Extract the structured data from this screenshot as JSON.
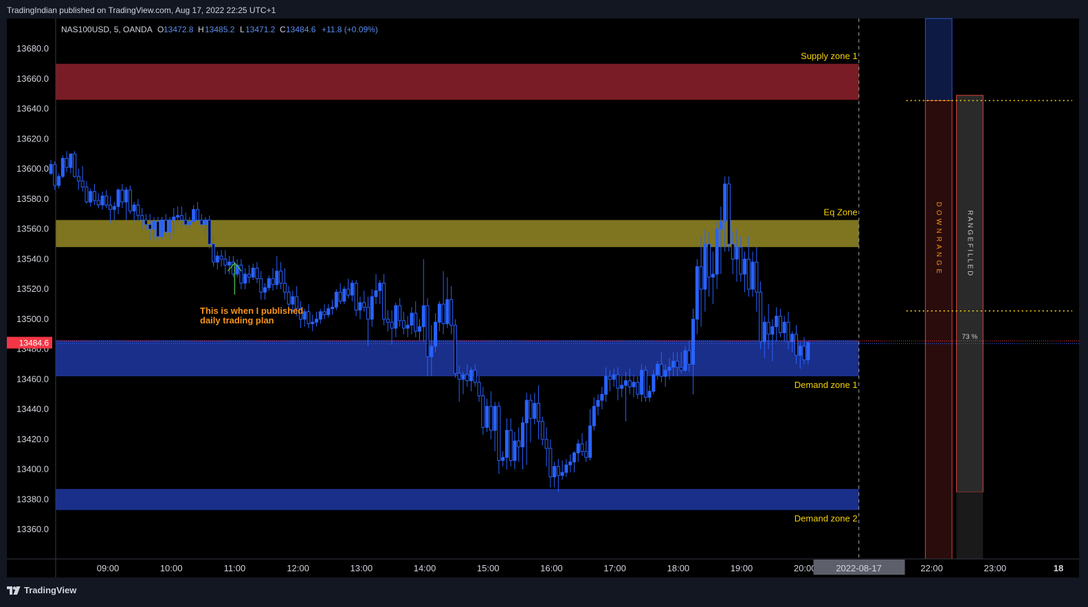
{
  "header": {
    "published_text": "TradingIndian published on TradingView.com, Aug 17, 2022 22:25 UTC+1"
  },
  "footer": {
    "brand": "TradingView"
  },
  "legend": {
    "symbol": "NAS100USD, 5, OANDA",
    "o_label": "O",
    "o_value": "13472.8",
    "h_label": "H",
    "h_value": "13485.2",
    "l_label": "L",
    "l_value": "13471.2",
    "c_label": "C",
    "c_value": "13484.6",
    "change": "+11.8 (+0.09%)"
  },
  "colors": {
    "background": "#000000",
    "frame": "#131722",
    "candle": "#2962ff",
    "supply_zone": "#7a1c25",
    "eq_zone": "#7f7520",
    "demand_zone": "#1a2f8a",
    "zone_label": "#f5d10a",
    "annotation": "#f7931a",
    "arrow": "#4caf50",
    "last_price": "#f23645"
  },
  "chart_data": {
    "type": "candlestick",
    "symbol": "NAS100USD",
    "timeframe": "5",
    "exchange": "OANDA",
    "ylim": [
      13340,
      13695
    ],
    "yticks": [
      13680.0,
      13660.0,
      13640.0,
      13620.0,
      13600.0,
      13580.0,
      13560.0,
      13540.0,
      13520.0,
      13500.0,
      13480.0,
      13460.0,
      13440.0,
      13420.0,
      13400.0,
      13380.0,
      13360.0
    ],
    "x_start_hour": 8.1,
    "x_end_hour": 24.0,
    "xticks": [
      {
        "hour": 9,
        "label": "09:00"
      },
      {
        "hour": 10,
        "label": "10:00"
      },
      {
        "hour": 11,
        "label": "11:00"
      },
      {
        "hour": 12,
        "label": "12:00"
      },
      {
        "hour": 13,
        "label": "13:00"
      },
      {
        "hour": 14,
        "label": "14:00"
      },
      {
        "hour": 15,
        "label": "15:00"
      },
      {
        "hour": 16,
        "label": "16:00"
      },
      {
        "hour": 17,
        "label": "17:00"
      },
      {
        "hour": 18,
        "label": "18:00"
      },
      {
        "hour": 19,
        "label": "19:00"
      },
      {
        "hour": 20,
        "label": "20:00"
      },
      {
        "hour": 21,
        "label": "21:00"
      },
      {
        "hour": 22,
        "label": "22:00"
      },
      {
        "hour": 23,
        "label": "23:00"
      },
      {
        "hour": 24,
        "label": "18"
      }
    ],
    "current_time_label": "2022-08-17",
    "current_time_hour": 20.85,
    "last_price": 13484.6,
    "last_price_label": "13484.6",
    "zones": [
      {
        "name": "Supply zone 1",
        "top": 13670,
        "bottom": 13646,
        "color": "#7a1c25"
      },
      {
        "name": "Eq Zone",
        "top": 13566,
        "bottom": 13548,
        "color": "#7f7520"
      },
      {
        "name": "Demand zone 1",
        "top": 13486,
        "bottom": 13462,
        "color": "#1a2f8a"
      },
      {
        "name": "Demand zone 2",
        "top": 13387,
        "bottom": 13373,
        "color": "#1a2f8a"
      }
    ],
    "dotted_levels": [
      13645.5,
      13505.5
    ],
    "down_range": {
      "label": "DOWN RANGE",
      "top": 13645.5,
      "bottom": 13340,
      "above_top": 13695
    },
    "range_filled": {
      "label": "RANGE FILLED",
      "percent": "73 %",
      "top": 13649,
      "bottom": 13385
    },
    "annotation": {
      "line1": "This is when I published",
      "line2": "daily trading plan",
      "hour": 11.0,
      "price": 13542
    },
    "candles": [
      [
        13597,
        13606,
        13596,
        13603
      ],
      [
        13603,
        13605,
        13586,
        13589
      ],
      [
        13589,
        13597,
        13587,
        13595
      ],
      [
        13595,
        13609,
        13594,
        13607
      ],
      [
        13607,
        13612,
        13598,
        13601
      ],
      [
        13601,
        13610,
        13597,
        13610
      ],
      [
        13610,
        13612,
        13594,
        13595
      ],
      [
        13595,
        13600,
        13586,
        13592
      ],
      [
        13592,
        13602,
        13585,
        13588
      ],
      [
        13588,
        13592,
        13577,
        13578
      ],
      [
        13578,
        13587,
        13575,
        13585
      ],
      [
        13585,
        13590,
        13576,
        13579
      ],
      [
        13579,
        13584,
        13574,
        13576
      ],
      [
        13576,
        13585,
        13573,
        13582
      ],
      [
        13582,
        13586,
        13574,
        13576
      ],
      [
        13576,
        13582,
        13564,
        13573
      ],
      [
        13573,
        13578,
        13566,
        13575
      ],
      [
        13575,
        13587,
        13570,
        13586
      ],
      [
        13586,
        13590,
        13574,
        13578
      ],
      [
        13578,
        13588,
        13566,
        13586
      ],
      [
        13586,
        13589,
        13570,
        13572
      ],
      [
        13572,
        13578,
        13565,
        13576
      ],
      [
        13576,
        13580,
        13566,
        13569
      ],
      [
        13569,
        13574,
        13560,
        13566
      ],
      [
        13566,
        13570,
        13559,
        13563
      ],
      [
        13563,
        13570,
        13553,
        13560
      ],
      [
        13560,
        13568,
        13552,
        13565
      ],
      [
        13565,
        13568,
        13553,
        13555
      ],
      [
        13555,
        13568,
        13553,
        13566
      ],
      [
        13566,
        13570,
        13555,
        13558
      ],
      [
        13558,
        13568,
        13553,
        13566
      ],
      [
        13566,
        13574,
        13557,
        13568
      ],
      [
        13568,
        13575,
        13563,
        13569
      ],
      [
        13569,
        13575,
        13561,
        13566
      ],
      [
        13566,
        13571,
        13562,
        13563
      ],
      [
        13563,
        13568,
        13560,
        13565
      ],
      [
        13565,
        13576,
        13563,
        13573
      ],
      [
        13573,
        13578,
        13565,
        13566
      ],
      [
        13566,
        13570,
        13561,
        13563
      ],
      [
        13563,
        13568,
        13556,
        13566
      ],
      [
        13566,
        13569,
        13547,
        13550
      ],
      [
        13550,
        13556,
        13535,
        13538
      ],
      [
        13538,
        13545,
        13533,
        13542
      ],
      [
        13542,
        13546,
        13535,
        13540
      ],
      [
        13540,
        13546,
        13530,
        13536
      ],
      [
        13536,
        13542,
        13530,
        13538
      ],
      [
        13538,
        13542,
        13528,
        13530
      ],
      [
        13530,
        13540,
        13528,
        13536
      ],
      [
        13536,
        13540,
        13520,
        13524
      ],
      [
        13524,
        13534,
        13520,
        13530
      ],
      [
        13530,
        13536,
        13524,
        13528
      ],
      [
        13528,
        13537,
        13526,
        13534
      ],
      [
        13534,
        13538,
        13524,
        13527
      ],
      [
        13527,
        13532,
        13513,
        13518
      ],
      [
        13518,
        13524,
        13513,
        13521
      ],
      [
        13521,
        13529,
        13519,
        13527
      ],
      [
        13527,
        13534,
        13519,
        13523
      ],
      [
        13523,
        13542,
        13520,
        13532
      ],
      [
        13532,
        13538,
        13520,
        13524
      ],
      [
        13524,
        13534,
        13513,
        13518
      ],
      [
        13518,
        13522,
        13505,
        13510
      ],
      [
        13510,
        13519,
        13505,
        13515
      ],
      [
        13515,
        13522,
        13502,
        13507
      ],
      [
        13507,
        13512,
        13494,
        13500
      ],
      [
        13500,
        13507,
        13495,
        13505
      ],
      [
        13505,
        13510,
        13494,
        13497
      ],
      [
        13497,
        13503,
        13492,
        13498
      ],
      [
        13498,
        13505,
        13495,
        13500
      ],
      [
        13500,
        13507,
        13497,
        13505
      ],
      [
        13505,
        13510,
        13500,
        13503
      ],
      [
        13503,
        13510,
        13501,
        13507
      ],
      [
        13507,
        13513,
        13503,
        13508
      ],
      [
        13508,
        13520,
        13506,
        13518
      ],
      [
        13518,
        13524,
        13510,
        13512
      ],
      [
        13512,
        13522,
        13510,
        13520
      ],
      [
        13520,
        13527,
        13514,
        13516
      ],
      [
        13516,
        13526,
        13512,
        13524
      ],
      [
        13524,
        13526,
        13502,
        13506
      ],
      [
        13506,
        13515,
        13500,
        13511
      ],
      [
        13511,
        13519,
        13505,
        13508
      ],
      [
        13508,
        13515,
        13482,
        13500
      ],
      [
        13500,
        13520,
        13495,
        13515
      ],
      [
        13515,
        13530,
        13510,
        13519
      ],
      [
        13519,
        13526,
        13510,
        13524
      ],
      [
        13524,
        13530,
        13496,
        13500
      ],
      [
        13500,
        13506,
        13492,
        13498
      ],
      [
        13498,
        13506,
        13483,
        13494
      ],
      [
        13494,
        13511,
        13488,
        13509
      ],
      [
        13509,
        13514,
        13495,
        13499
      ],
      [
        13499,
        13505,
        13490,
        13494
      ],
      [
        13494,
        13502,
        13488,
        13496
      ],
      [
        13496,
        13508,
        13490,
        13504
      ],
      [
        13504,
        13512,
        13488,
        13492
      ],
      [
        13492,
        13500,
        13486,
        13495
      ],
      [
        13495,
        13540,
        13485,
        13509
      ],
      [
        13509,
        13514,
        13462,
        13475
      ],
      [
        13475,
        13496,
        13462,
        13482
      ],
      [
        13482,
        13504,
        13478,
        13498
      ],
      [
        13498,
        13512,
        13492,
        13510
      ],
      [
        13510,
        13532,
        13490,
        13497
      ],
      [
        13497,
        13528,
        13494,
        13513
      ],
      [
        13513,
        13522,
        13490,
        13496
      ],
      [
        13496,
        13500,
        13461,
        13464
      ],
      [
        13464,
        13469,
        13445,
        13460
      ],
      [
        13460,
        13465,
        13450,
        13463
      ],
      [
        13463,
        13470,
        13455,
        13459
      ],
      [
        13459,
        13468,
        13452,
        13466
      ],
      [
        13466,
        13470,
        13455,
        13458
      ],
      [
        13458,
        13462,
        13445,
        13449
      ],
      [
        13449,
        13455,
        13423,
        13428
      ],
      [
        13428,
        13447,
        13425,
        13442
      ],
      [
        13442,
        13452,
        13420,
        13426
      ],
      [
        13426,
        13445,
        13412,
        13442
      ],
      [
        13442,
        13445,
        13397,
        13406
      ],
      [
        13406,
        13412,
        13402,
        13408
      ],
      [
        13408,
        13434,
        13400,
        13426
      ],
      [
        13426,
        13434,
        13402,
        13406
      ],
      [
        13406,
        13425,
        13400,
        13419
      ],
      [
        13419,
        13428,
        13405,
        13415
      ],
      [
        13415,
        13435,
        13400,
        13431
      ],
      [
        13431,
        13451,
        13403,
        13446
      ],
      [
        13446,
        13450,
        13418,
        13434
      ],
      [
        13434,
        13451,
        13430,
        13444
      ],
      [
        13444,
        13456,
        13420,
        13432
      ],
      [
        13432,
        13435,
        13416,
        13420
      ],
      [
        13420,
        13428,
        13402,
        13414
      ],
      [
        13414,
        13420,
        13388,
        13395
      ],
      [
        13395,
        13405,
        13388,
        13402
      ],
      [
        13402,
        13407,
        13385,
        13396
      ],
      [
        13396,
        13406,
        13393,
        13398
      ],
      [
        13398,
        13407,
        13395,
        13403
      ],
      [
        13403,
        13410,
        13398,
        13405
      ],
      [
        13405,
        13412,
        13398,
        13411
      ],
      [
        13411,
        13420,
        13405,
        13417
      ],
      [
        13417,
        13424,
        13409,
        13412
      ],
      [
        13412,
        13419,
        13405,
        13408
      ],
      [
        13408,
        13440,
        13406,
        13429
      ],
      [
        13429,
        13448,
        13426,
        13442
      ],
      [
        13442,
        13450,
        13436,
        13446
      ],
      [
        13446,
        13455,
        13440,
        13450
      ],
      [
        13450,
        13468,
        13445,
        13462
      ],
      [
        13462,
        13466,
        13452,
        13460
      ],
      [
        13460,
        13467,
        13455,
        13463
      ],
      [
        13463,
        13468,
        13446,
        13454
      ],
      [
        13454,
        13462,
        13448,
        13456
      ],
      [
        13456,
        13465,
        13432,
        13459
      ],
      [
        13459,
        13467,
        13450,
        13455
      ],
      [
        13455,
        13463,
        13448,
        13458
      ],
      [
        13458,
        13462,
        13447,
        13450
      ],
      [
        13450,
        13470,
        13445,
        13466
      ],
      [
        13466,
        13469,
        13445,
        13448
      ],
      [
        13448,
        13456,
        13445,
        13452
      ],
      [
        13452,
        13466,
        13450,
        13463
      ],
      [
        13463,
        13472,
        13460,
        13470
      ],
      [
        13470,
        13478,
        13458,
        13462
      ],
      [
        13462,
        13470,
        13455,
        13466
      ],
      [
        13466,
        13474,
        13460,
        13468
      ],
      [
        13468,
        13478,
        13462,
        13472
      ],
      [
        13472,
        13478,
        13462,
        13468
      ],
      [
        13468,
        13478,
        13464,
        13466
      ],
      [
        13466,
        13482,
        13465,
        13479
      ],
      [
        13479,
        13486,
        13465,
        13470
      ],
      [
        13470,
        13507,
        13450,
        13500
      ],
      [
        13500,
        13540,
        13490,
        13535
      ],
      [
        13535,
        13555,
        13495,
        13520
      ],
      [
        13520,
        13560,
        13505,
        13550
      ],
      [
        13550,
        13558,
        13515,
        13528
      ],
      [
        13528,
        13545,
        13510,
        13530
      ],
      [
        13530,
        13565,
        13520,
        13560
      ],
      [
        13560,
        13575,
        13530,
        13565
      ],
      [
        13565,
        13595,
        13545,
        13590
      ],
      [
        13590,
        13595,
        13545,
        13550
      ],
      [
        13550,
        13558,
        13530,
        13540
      ],
      [
        13540,
        13560,
        13525,
        13548
      ],
      [
        13548,
        13555,
        13525,
        13530
      ],
      [
        13530,
        13545,
        13518,
        13540
      ],
      [
        13540,
        13555,
        13515,
        13520
      ],
      [
        13520,
        13545,
        13515,
        13538
      ],
      [
        13538,
        13548,
        13505,
        13518
      ],
      [
        13518,
        13525,
        13480,
        13485
      ],
      [
        13485,
        13502,
        13474,
        13498
      ],
      [
        13498,
        13510,
        13480,
        13490
      ],
      [
        13490,
        13500,
        13472,
        13495
      ],
      [
        13495,
        13508,
        13485,
        13502
      ],
      [
        13502,
        13507,
        13488,
        13491
      ],
      [
        13491,
        13502,
        13485,
        13498
      ],
      [
        13498,
        13505,
        13480,
        13485
      ],
      [
        13485,
        13492,
        13478,
        13490
      ],
      [
        13490,
        13496,
        13470,
        13476
      ],
      [
        13476,
        13485,
        13467,
        13482
      ],
      [
        13482,
        13488,
        13470,
        13473
      ],
      [
        13473,
        13485,
        13470,
        13484.6
      ]
    ]
  }
}
